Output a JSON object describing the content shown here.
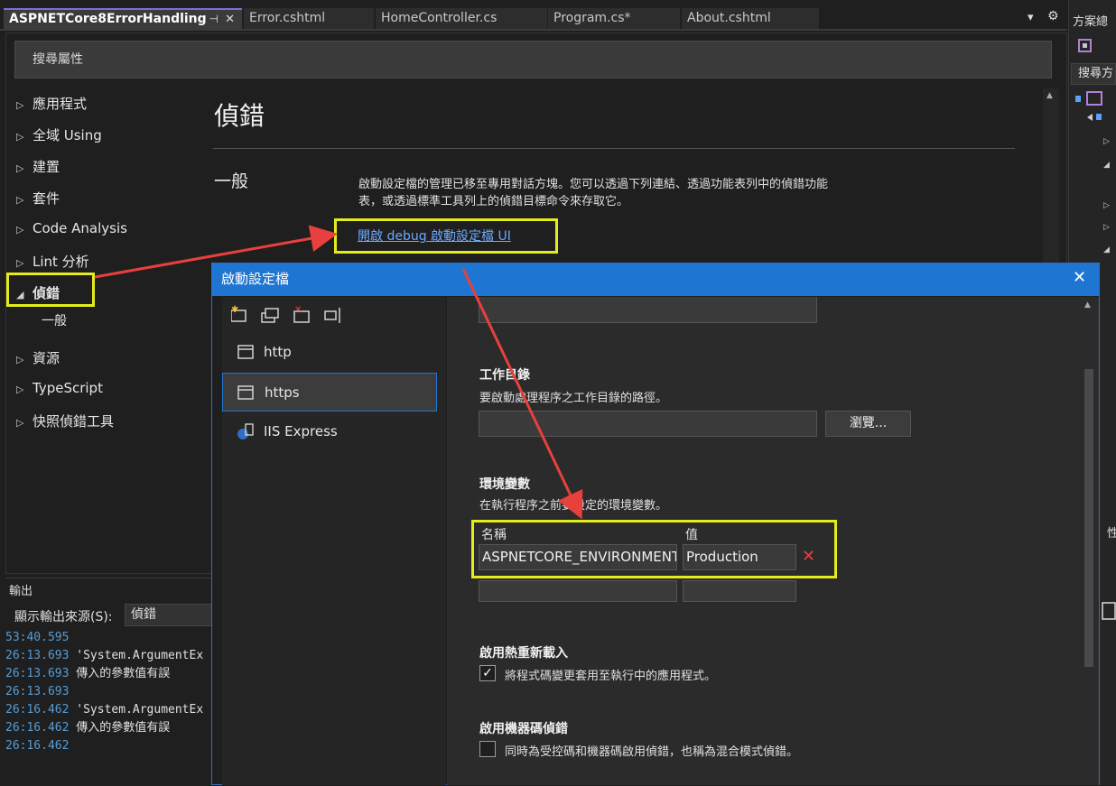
{
  "tabs": [
    {
      "label": "ASPNETCore8ErrorHandling",
      "active": true
    },
    {
      "label": "Error.cshtml"
    },
    {
      "label": "HomeController.cs"
    },
    {
      "label": "Program.cs*"
    },
    {
      "label": "About.cshtml"
    }
  ],
  "tab_controls": {
    "pin": "⊣",
    "close": "✕",
    "dropdown": "▾",
    "settings": "⚙"
  },
  "search": {
    "placeholder": "搜尋屬性"
  },
  "nav": {
    "items": [
      "應用程式",
      "全域 Using",
      "建置",
      "套件",
      "Code Analysis",
      "Lint 分析",
      "偵錯",
      "一般",
      "資源",
      "TypeScript",
      "快照偵錯工具"
    ]
  },
  "page": {
    "title": "偵錯",
    "section": "一般",
    "description_line1": "啟動設定檔的管理已移至專用對話方塊。您可以透過下列連結、透過功能表列中的偵錯功能",
    "description_line2": "表，或透過標準工具列上的偵錯目標命令來存取它。",
    "link": "開啟 debug 啟動設定檔 UI"
  },
  "output": {
    "title": "輸出",
    "source_label": "顯示輸出來源(S):",
    "source_value": "偵錯",
    "lines": [
      {
        "time": "53:40.595",
        "text": ""
      },
      {
        "time": "26:13.693",
        "text": "'System.ArgumentEx"
      },
      {
        "time": "26:13.693",
        "text": "傳入的參數值有誤"
      },
      {
        "time": "26:13.693",
        "text": ""
      },
      {
        "time": "26:16.462",
        "text": "'System.ArgumentEx"
      },
      {
        "time": "26:16.462",
        "text": "傳入的參數值有誤"
      },
      {
        "time": "26:16.462",
        "text": ""
      }
    ]
  },
  "right_pane": {
    "title": "方案總",
    "search": "搜尋方",
    "bottom": "性"
  },
  "dialog": {
    "title": "啟動設定檔",
    "close": "✕",
    "profiles": [
      "http",
      "https",
      "IIS Express"
    ],
    "selected_profile": "https",
    "workdir_label": "工作目錄",
    "workdir_desc": "要啟動處理程序之工作目錄的路徑。",
    "browse": "瀏覽...",
    "env_label": "環境變數",
    "env_desc": "在執行程序之前要設定的環境變數。",
    "env_name_header": "名稱",
    "env_value_header": "值",
    "env_name": "ASPNETCORE_ENVIRONMENT",
    "env_value": "Production",
    "env_delete": "✕",
    "hot_reload_label": "啟用熱重新載入",
    "hot_reload_desc": "將程式碼變更套用至執行中的應用程式。",
    "hot_reload_checked": true,
    "native_label": "啟用機器碼偵錯",
    "native_desc": "同時為受控碼和機器碼啟用偵錯，也稱為混合模式偵錯。",
    "native_checked": false
  },
  "colors": {
    "accent": "#1f76d2",
    "highlight": "#e5ec1b",
    "arrow": "#e8403c",
    "link": "#6aa9ff"
  }
}
